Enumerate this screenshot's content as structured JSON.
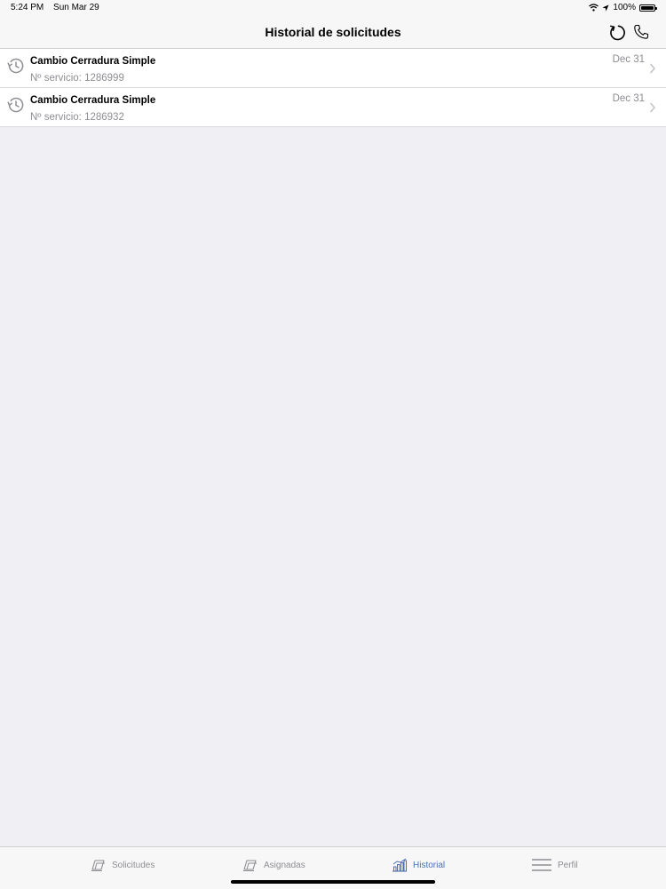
{
  "status_bar": {
    "time": "5:24 PM",
    "date": "Sun Mar 29",
    "battery": "100%",
    "battery_level": 1.0
  },
  "nav": {
    "title": "Historial de solicitudes",
    "refresh_icon": "refresh-icon",
    "phone_icon": "phone-icon"
  },
  "requests": [
    {
      "title": "Cambio Cerradura Simple",
      "subtitle": "Nº servicio: 1286999",
      "date": "Dec 31",
      "icon": "history-icon"
    },
    {
      "title": "Cambio Cerradura Simple",
      "subtitle": "Nº servicio: 1286932",
      "date": "Dec 31",
      "icon": "history-icon"
    }
  ],
  "tabs": [
    {
      "label": "Solicitudes",
      "icon": "document-icon",
      "active": false
    },
    {
      "label": "Asignadas",
      "icon": "document-icon",
      "active": false
    },
    {
      "label": "Historial",
      "icon": "chart-icon",
      "active": true
    },
    {
      "label": "Perfil",
      "icon": "menu-icon",
      "active": false
    }
  ],
  "colors": {
    "accent": "#4a6fb5",
    "inactive": "#8e8e93",
    "background": "#efeff4"
  }
}
